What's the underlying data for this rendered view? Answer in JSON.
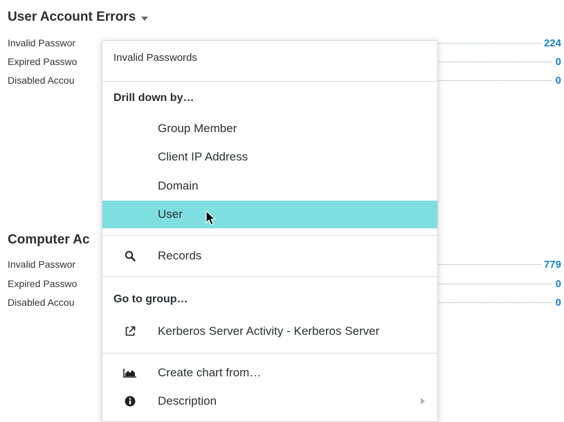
{
  "colors": {
    "accent_value": "#1a7fc4",
    "highlight": "#7fdfe0"
  },
  "user_account_errors": {
    "title": "User Account Errors",
    "rows": [
      {
        "label": "Invalid Passwor",
        "value": "224"
      },
      {
        "label": "Expired Passwo",
        "value": "0"
      },
      {
        "label": "Disabled Accou",
        "value": "0"
      }
    ]
  },
  "computer_account_errors": {
    "title": "Computer Ac",
    "rows": [
      {
        "label": "Invalid Passwor",
        "value": "779"
      },
      {
        "label": "Expired Passwo",
        "value": "0"
      },
      {
        "label": "Disabled Accou",
        "value": "0"
      }
    ]
  },
  "context_menu": {
    "header": "Invalid Passwords",
    "drill_down_title": "Drill down by…",
    "drill_down_items": [
      "Group Member",
      "Client IP Address",
      "Domain",
      "User"
    ],
    "highlighted_item": "User",
    "records": {
      "label": "Records",
      "icon": "search-icon"
    },
    "go_to_group_title": "Go to group…",
    "go_to_group_item": {
      "label": "Kerberos Server Activity - Kerberos Server",
      "icon": "external-link-icon"
    },
    "create_chart": {
      "label": "Create chart from…",
      "icon": "area-chart-icon"
    },
    "description": {
      "label": "Description",
      "icon": "info-icon"
    }
  }
}
